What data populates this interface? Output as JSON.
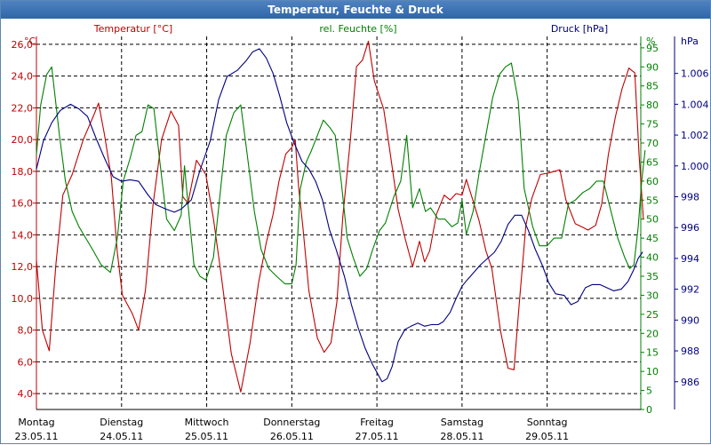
{
  "window": {
    "title": "Temperatur, Feuchte & Druck"
  },
  "colors": {
    "temperature": "#c00000",
    "humidity": "#008000",
    "pressure": "#000080",
    "grid": "#000000",
    "axis": "#000000"
  },
  "chart_data": {
    "type": "line",
    "title": "Temperatur, Feuchte & Druck",
    "grid": true,
    "x_ticks": [
      {
        "day": "Montag",
        "date": "23.05.11"
      },
      {
        "day": "Dienstag",
        "date": "24.05.11"
      },
      {
        "day": "Mittwoch",
        "date": "25.05.11"
      },
      {
        "day": "Donnerstag",
        "date": "26.05.11"
      },
      {
        "day": "Freitag",
        "date": "27.05.11"
      },
      {
        "day": "Samstag",
        "date": "28.05.11"
      },
      {
        "day": "Sonntag",
        "date": "29.05.11"
      }
    ],
    "xlim": [
      0,
      7.1
    ],
    "axes": {
      "left": {
        "label": "Temperatur [°C]",
        "unit": "°C",
        "ylim": [
          3,
          26.5
        ],
        "ticks": [
          "4,0",
          "6,0",
          "8,0",
          "10,0",
          "12,0",
          "14,0",
          "16,0",
          "18,0",
          "20,0",
          "22,0",
          "24,0",
          "26,0"
        ]
      },
      "right_inner": {
        "label": "rel. Feuchte [%]",
        "unit": "%",
        "ylim": [
          0,
          98
        ],
        "ticks": [
          "0",
          "5",
          "10",
          "15",
          "20",
          "25",
          "30",
          "35",
          "40",
          "45",
          "50",
          "55",
          "60",
          "65",
          "70",
          "75",
          "80",
          "85",
          "90",
          "95"
        ]
      },
      "right_outer": {
        "label": "Druck [hPa]",
        "unit": "hPa",
        "ylim": [
          984.2,
          1008.4
        ],
        "ticks": [
          "986",
          "988",
          "990",
          "992",
          "994",
          "996",
          "998",
          "1.000",
          "1.002",
          "1.004",
          "1.006"
        ]
      }
    },
    "series": [
      {
        "name": "Temperatur [°C]",
        "axis": "left",
        "points": [
          [
            0.0,
            12.4
          ],
          [
            0.07,
            8.0
          ],
          [
            0.15,
            6.7
          ],
          [
            0.23,
            12.2
          ],
          [
            0.31,
            16.5
          ],
          [
            0.42,
            17.8
          ],
          [
            0.55,
            20.0
          ],
          [
            0.67,
            21.5
          ],
          [
            0.73,
            22.3
          ],
          [
            0.8,
            20.3
          ],
          [
            0.88,
            17.6
          ],
          [
            0.95,
            12.9
          ],
          [
            1.01,
            10.2
          ],
          [
            1.13,
            9.0
          ],
          [
            1.2,
            8.0
          ],
          [
            1.28,
            10.5
          ],
          [
            1.37,
            15.9
          ],
          [
            1.47,
            20.0
          ],
          [
            1.58,
            21.8
          ],
          [
            1.67,
            20.9
          ],
          [
            1.72,
            16.4
          ],
          [
            1.78,
            16.0
          ],
          [
            1.88,
            18.7
          ],
          [
            1.99,
            17.8
          ],
          [
            2.08,
            15.0
          ],
          [
            2.17,
            11.5
          ],
          [
            2.29,
            6.5
          ],
          [
            2.4,
            4.1
          ],
          [
            2.51,
            7.2
          ],
          [
            2.61,
            11.0
          ],
          [
            2.7,
            13.5
          ],
          [
            2.78,
            15.3
          ],
          [
            2.85,
            17.4
          ],
          [
            2.93,
            19.1
          ],
          [
            3.0,
            19.5
          ],
          [
            3.04,
            20.0
          ],
          [
            3.08,
            17.0
          ],
          [
            3.13,
            14.5
          ],
          [
            3.2,
            10.5
          ],
          [
            3.3,
            7.5
          ],
          [
            3.38,
            6.6
          ],
          [
            3.46,
            7.2
          ],
          [
            3.53,
            9.8
          ],
          [
            3.6,
            15.2
          ],
          [
            3.69,
            20.1
          ],
          [
            3.76,
            24.6
          ],
          [
            3.83,
            25.0
          ],
          [
            3.9,
            26.2
          ],
          [
            3.97,
            23.7
          ],
          [
            4.08,
            21.9
          ],
          [
            4.16,
            19.0
          ],
          [
            4.25,
            15.6
          ],
          [
            4.33,
            13.8
          ],
          [
            4.42,
            12.0
          ],
          [
            4.5,
            13.6
          ],
          [
            4.56,
            12.3
          ],
          [
            4.62,
            13.0
          ],
          [
            4.7,
            15.3
          ],
          [
            4.79,
            16.5
          ],
          [
            4.86,
            16.2
          ],
          [
            4.93,
            16.6
          ],
          [
            5.0,
            16.5
          ],
          [
            5.05,
            17.5
          ],
          [
            5.12,
            16.3
          ],
          [
            5.2,
            14.9
          ],
          [
            5.28,
            13.0
          ],
          [
            5.35,
            11.9
          ],
          [
            5.45,
            8.0
          ],
          [
            5.54,
            5.6
          ],
          [
            5.61,
            5.5
          ],
          [
            5.67,
            9.5
          ],
          [
            5.75,
            14.6
          ],
          [
            5.82,
            16.3
          ],
          [
            5.92,
            17.8
          ],
          [
            6.02,
            17.9
          ],
          [
            6.15,
            18.1
          ],
          [
            6.22,
            16.2
          ],
          [
            6.33,
            14.7
          ],
          [
            6.41,
            14.5
          ],
          [
            6.48,
            14.3
          ],
          [
            6.57,
            14.6
          ],
          [
            6.64,
            15.9
          ],
          [
            6.72,
            19.1
          ],
          [
            6.8,
            21.4
          ],
          [
            6.88,
            23.2
          ],
          [
            6.96,
            24.5
          ],
          [
            7.03,
            24.2
          ],
          [
            7.08,
            19.0
          ],
          [
            7.13,
            15.0
          ]
        ]
      },
      {
        "name": "rel. Feuchte [%]",
        "axis": "right_inner",
        "points": [
          [
            0.0,
            67
          ],
          [
            0.05,
            80
          ],
          [
            0.12,
            88
          ],
          [
            0.18,
            90
          ],
          [
            0.27,
            72
          ],
          [
            0.34,
            60
          ],
          [
            0.42,
            52
          ],
          [
            0.5,
            48
          ],
          [
            0.58,
            45
          ],
          [
            0.66,
            42
          ],
          [
            0.76,
            38
          ],
          [
            0.87,
            36
          ],
          [
            0.95,
            45
          ],
          [
            1.02,
            60
          ],
          [
            1.1,
            66
          ],
          [
            1.17,
            72
          ],
          [
            1.24,
            73
          ],
          [
            1.31,
            80
          ],
          [
            1.38,
            79
          ],
          [
            1.45,
            65
          ],
          [
            1.53,
            50
          ],
          [
            1.62,
            47
          ],
          [
            1.7,
            51
          ],
          [
            1.74,
            64
          ],
          [
            1.78,
            54
          ],
          [
            1.85,
            38
          ],
          [
            1.92,
            35
          ],
          [
            1.99,
            34
          ],
          [
            2.08,
            40
          ],
          [
            2.14,
            53
          ],
          [
            2.23,
            72
          ],
          [
            2.32,
            78
          ],
          [
            2.4,
            80
          ],
          [
            2.47,
            68
          ],
          [
            2.56,
            52
          ],
          [
            2.64,
            42
          ],
          [
            2.73,
            37
          ],
          [
            2.82,
            35
          ],
          [
            2.92,
            33
          ],
          [
            3.0,
            33
          ],
          [
            3.05,
            38
          ],
          [
            3.1,
            58
          ],
          [
            3.17,
            65
          ],
          [
            3.23,
            68
          ],
          [
            3.3,
            72
          ],
          [
            3.37,
            76
          ],
          [
            3.45,
            74
          ],
          [
            3.51,
            72
          ],
          [
            3.58,
            60
          ],
          [
            3.65,
            45
          ],
          [
            3.72,
            40
          ],
          [
            3.8,
            35
          ],
          [
            3.88,
            37
          ],
          [
            3.95,
            42
          ],
          [
            4.03,
            47
          ],
          [
            4.1,
            49
          ],
          [
            4.2,
            56
          ],
          [
            4.28,
            60
          ],
          [
            4.35,
            72
          ],
          [
            4.42,
            53
          ],
          [
            4.5,
            58
          ],
          [
            4.57,
            52
          ],
          [
            4.63,
            53
          ],
          [
            4.72,
            50
          ],
          [
            4.8,
            50
          ],
          [
            4.88,
            48
          ],
          [
            4.95,
            49
          ],
          [
            5.0,
            55
          ],
          [
            5.05,
            46
          ],
          [
            5.13,
            52
          ],
          [
            5.2,
            62
          ],
          [
            5.28,
            72
          ],
          [
            5.36,
            82
          ],
          [
            5.44,
            88
          ],
          [
            5.51,
            90
          ],
          [
            5.58,
            91
          ],
          [
            5.66,
            81
          ],
          [
            5.73,
            58
          ],
          [
            5.83,
            48
          ],
          [
            5.91,
            43
          ],
          [
            6.0,
            43
          ],
          [
            6.08,
            45
          ],
          [
            6.17,
            45
          ],
          [
            6.25,
            54
          ],
          [
            6.33,
            55
          ],
          [
            6.42,
            57
          ],
          [
            6.5,
            58
          ],
          [
            6.58,
            60
          ],
          [
            6.66,
            60
          ],
          [
            6.75,
            52
          ],
          [
            6.83,
            45
          ],
          [
            6.91,
            40
          ],
          [
            6.97,
            37
          ],
          [
            7.02,
            38
          ],
          [
            7.07,
            48
          ],
          [
            7.11,
            60
          ],
          [
            7.15,
            68
          ]
        ]
      },
      {
        "name": "Druck [hPa]",
        "axis": "right_outer",
        "points": [
          [
            0.0,
            999.8
          ],
          [
            0.08,
            1001.6
          ],
          [
            0.18,
            1002.8
          ],
          [
            0.28,
            1003.6
          ],
          [
            0.4,
            1004.0
          ],
          [
            0.5,
            1003.7
          ],
          [
            0.6,
            1003.2
          ],
          [
            0.7,
            1001.8
          ],
          [
            0.8,
            1000.5
          ],
          [
            0.9,
            999.3
          ],
          [
            1.0,
            999.0
          ],
          [
            1.1,
            999.1
          ],
          [
            1.2,
            999.0
          ],
          [
            1.3,
            998.2
          ],
          [
            1.4,
            997.5
          ],
          [
            1.52,
            997.2
          ],
          [
            1.62,
            997.0
          ],
          [
            1.7,
            997.2
          ],
          [
            1.76,
            997.5
          ],
          [
            1.82,
            997.8
          ],
          [
            1.92,
            999.7
          ],
          [
            2.04,
            1001.6
          ],
          [
            2.14,
            1004.3
          ],
          [
            2.24,
            1005.8
          ],
          [
            2.36,
            1006.2
          ],
          [
            2.46,
            1006.8
          ],
          [
            2.54,
            1007.4
          ],
          [
            2.62,
            1007.6
          ],
          [
            2.7,
            1007.0
          ],
          [
            2.78,
            1006.0
          ],
          [
            2.86,
            1004.5
          ],
          [
            2.94,
            1002.8
          ],
          [
            3.02,
            1001.6
          ],
          [
            3.12,
            1000.3
          ],
          [
            3.2,
            999.8
          ],
          [
            3.28,
            999.0
          ],
          [
            3.36,
            997.8
          ],
          [
            3.44,
            995.9
          ],
          [
            3.52,
            994.6
          ],
          [
            3.62,
            992.8
          ],
          [
            3.7,
            991.0
          ],
          [
            3.78,
            989.5
          ],
          [
            3.86,
            988.2
          ],
          [
            3.94,
            987.2
          ],
          [
            4.0,
            986.6
          ],
          [
            4.06,
            986.0
          ],
          [
            4.12,
            986.2
          ],
          [
            4.18,
            987.0
          ],
          [
            4.25,
            988.6
          ],
          [
            4.33,
            989.4
          ],
          [
            4.4,
            989.6
          ],
          [
            4.48,
            989.8
          ],
          [
            4.56,
            989.6
          ],
          [
            4.64,
            989.7
          ],
          [
            4.72,
            989.7
          ],
          [
            4.78,
            989.9
          ],
          [
            4.86,
            990.5
          ],
          [
            4.93,
            991.4
          ],
          [
            5.0,
            992.2
          ],
          [
            5.06,
            992.6
          ],
          [
            5.14,
            993.1
          ],
          [
            5.22,
            993.6
          ],
          [
            5.3,
            994.0
          ],
          [
            5.38,
            994.4
          ],
          [
            5.46,
            995.1
          ],
          [
            5.54,
            996.2
          ],
          [
            5.62,
            996.8
          ],
          [
            5.7,
            996.8
          ],
          [
            5.78,
            995.8
          ],
          [
            5.86,
            994.6
          ],
          [
            5.94,
            993.6
          ],
          [
            6.02,
            992.4
          ],
          [
            6.1,
            991.7
          ],
          [
            6.2,
            991.6
          ],
          [
            6.28,
            991.0
          ],
          [
            6.36,
            991.2
          ],
          [
            6.45,
            992.1
          ],
          [
            6.53,
            992.3
          ],
          [
            6.62,
            992.3
          ],
          [
            6.7,
            992.1
          ],
          [
            6.78,
            991.9
          ],
          [
            6.87,
            992.0
          ],
          [
            6.95,
            992.5
          ],
          [
            7.02,
            993.3
          ],
          [
            7.07,
            994.0
          ],
          [
            7.12,
            994.4
          ]
        ]
      }
    ]
  }
}
